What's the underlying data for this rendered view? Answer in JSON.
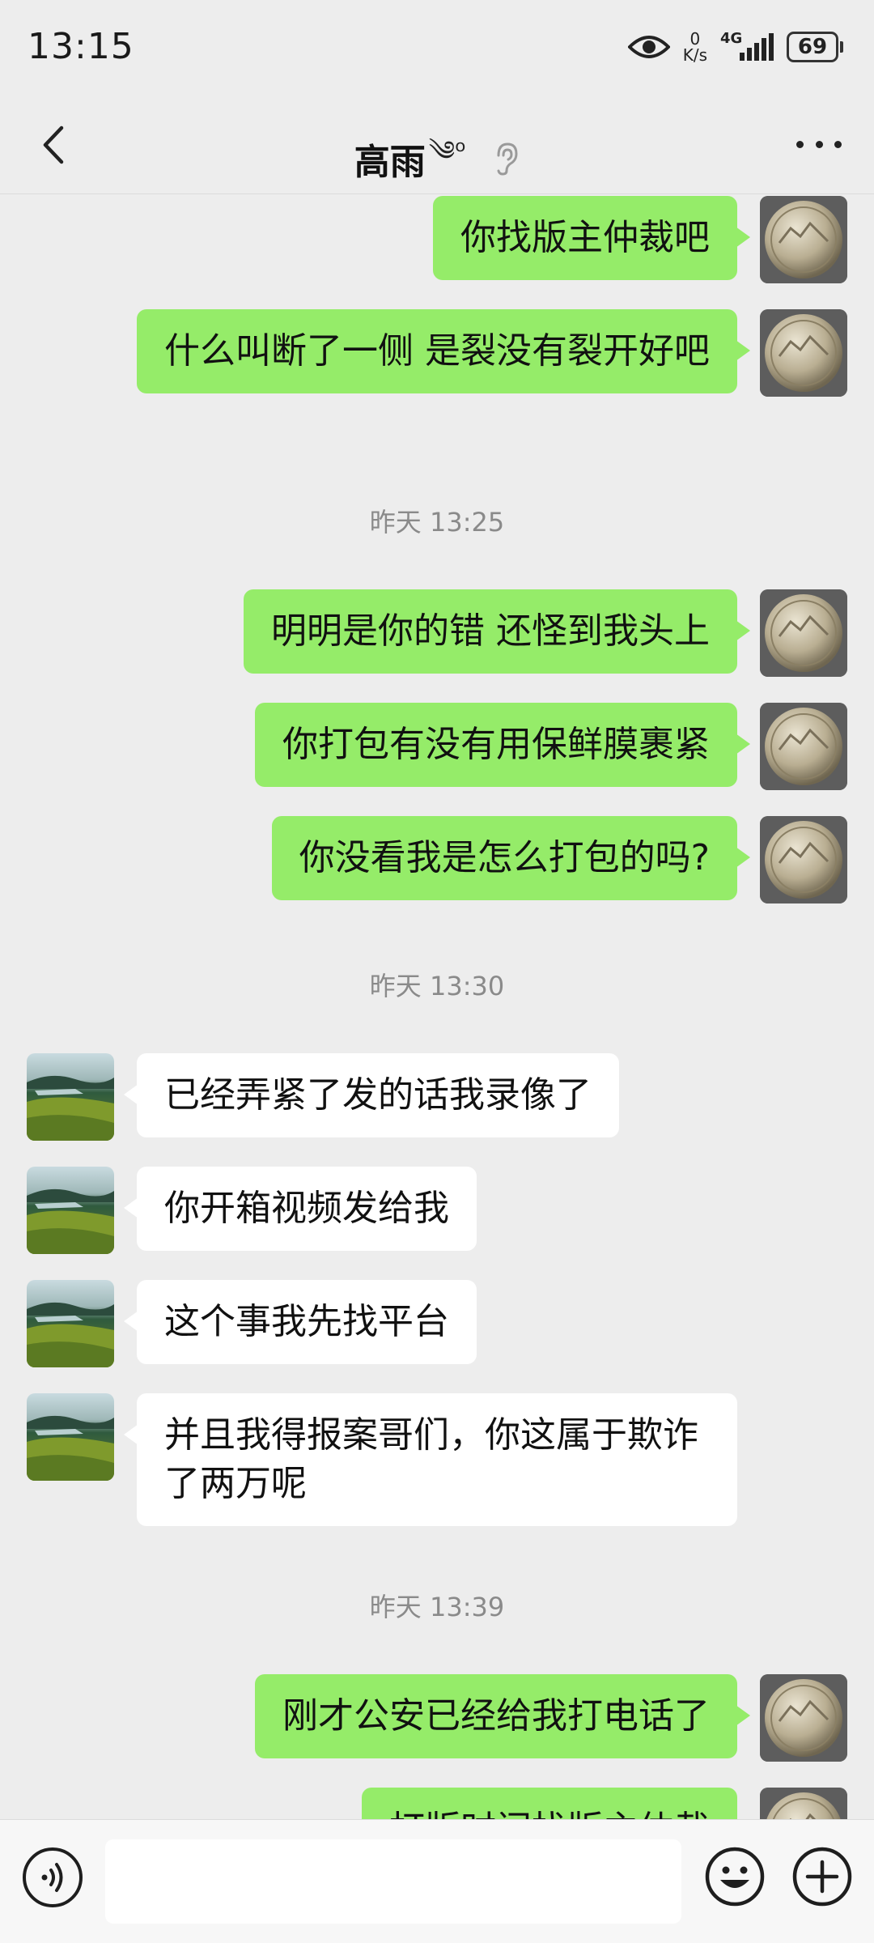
{
  "status_bar": {
    "time": "13:15",
    "net_speed_value": "0",
    "net_speed_unit": "K/s",
    "network": "4G",
    "battery": "69"
  },
  "header": {
    "contact_name": "高雨",
    "name_decoration": "༄ᵒ",
    "icons": [
      "back-arrow-icon",
      "ear-icon",
      "more-icon"
    ]
  },
  "messages": [
    {
      "type": "sent",
      "text": "你找版主仲裁吧"
    },
    {
      "type": "sent",
      "text": "什么叫断了一侧 是裂没有裂开好吧"
    },
    {
      "type": "time",
      "text": "昨天 13:25"
    },
    {
      "type": "sent",
      "text": "明明是你的错 还怪到我头上"
    },
    {
      "type": "sent",
      "text": "你打包有没有用保鲜膜裹紧"
    },
    {
      "type": "sent",
      "text": "你没看我是怎么打包的吗?"
    },
    {
      "type": "time",
      "text": "昨天 13:30"
    },
    {
      "type": "received",
      "text": "已经弄紧了发的话我录像了"
    },
    {
      "type": "received",
      "text": "你开箱视频发给我"
    },
    {
      "type": "received",
      "text": "这个事我先找平台"
    },
    {
      "type": "received",
      "text": "并且我得报案哥们，你这属于欺诈了两万呢"
    },
    {
      "type": "time",
      "text": "昨天 13:39"
    },
    {
      "type": "sent",
      "text": "刚才公安已经给我打电话了"
    },
    {
      "type": "sent",
      "text": "打版时间找版主仲裁"
    }
  ],
  "input_bar": {
    "placeholder": "",
    "icons": [
      "voice-icon",
      "emoji-icon",
      "plus-icon"
    ]
  },
  "colors": {
    "background": "#ededed",
    "sent_bubble": "#95ec69",
    "received_bubble": "#ffffff",
    "timestamp_text": "#8a8a8a"
  }
}
